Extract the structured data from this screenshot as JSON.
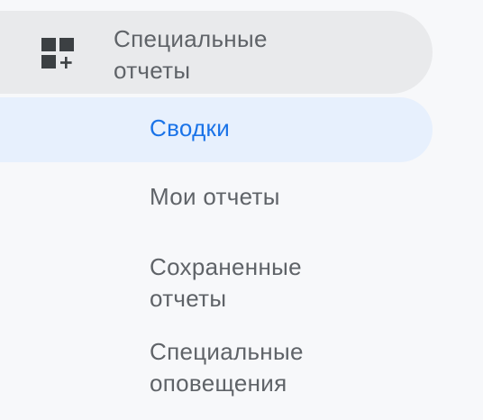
{
  "section": {
    "icon": "add-dashboard-icon",
    "label": "Специальные\nотчеты"
  },
  "items": [
    {
      "label": "Сводки",
      "active": true
    },
    {
      "label": "Мои отчеты",
      "active": false
    },
    {
      "label": "Сохраненные\nотчеты",
      "active": false
    },
    {
      "label": "Специальные\nоповещения",
      "active": false
    }
  ],
  "colors": {
    "active_text": "#1a73e8",
    "active_bg": "#e7f0fd",
    "header_bg": "#e9eaec",
    "text": "#5f6368"
  }
}
